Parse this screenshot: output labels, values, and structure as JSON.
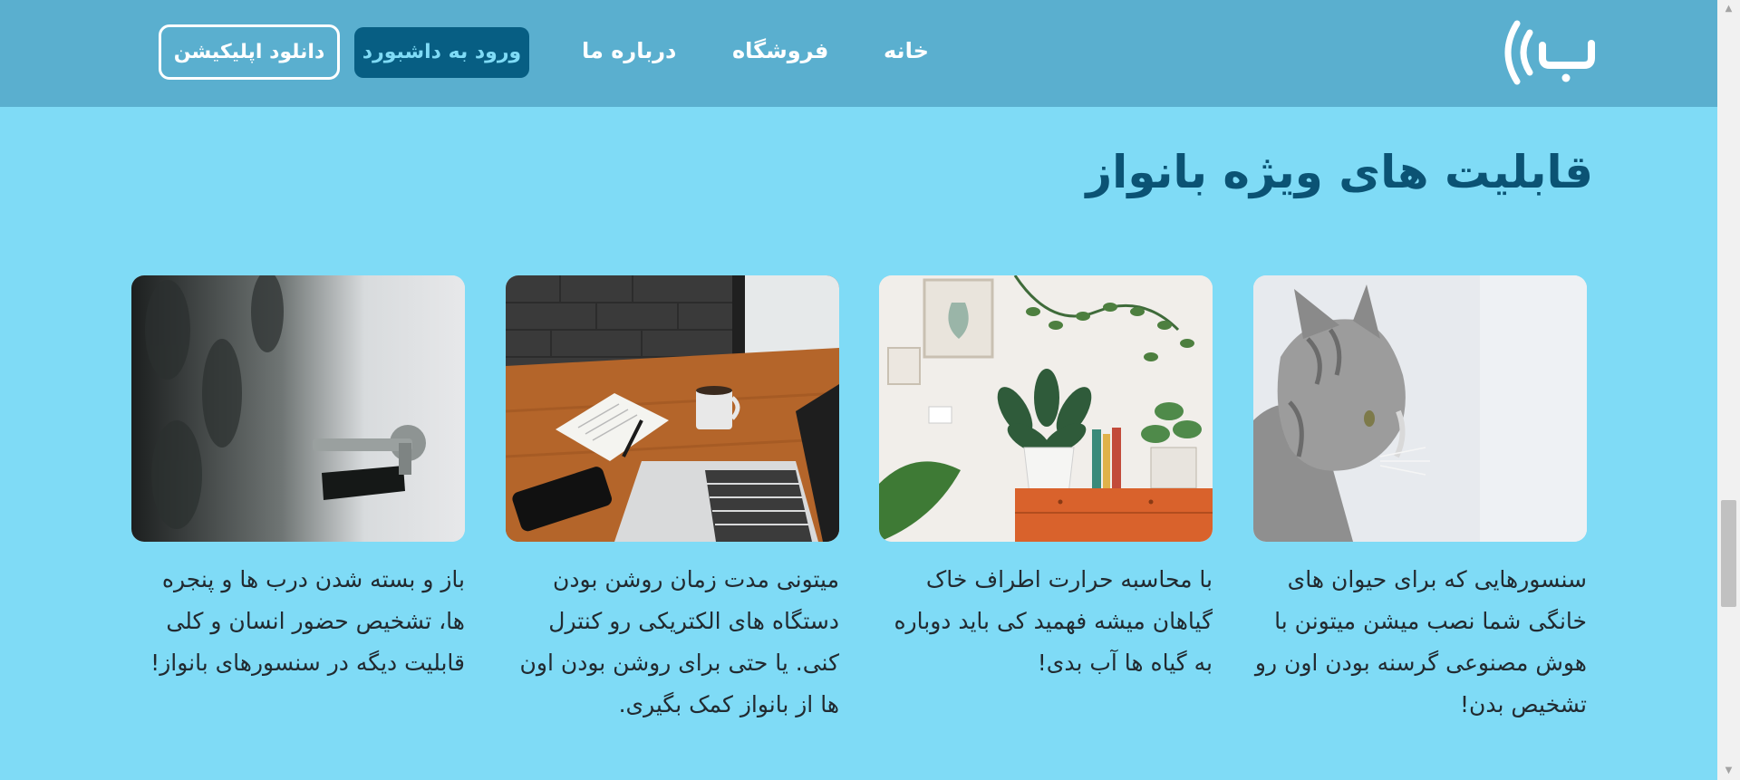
{
  "header": {
    "logo_alt": "بانواز",
    "nav": {
      "home": "خانه",
      "shop": "فروشگاه",
      "about": "درباره ما"
    },
    "dashboard_button": "ورود به داشبورد",
    "download_button": "دانلود اپلیکیشن"
  },
  "section": {
    "title": "قابلیت های ویژه بانواز"
  },
  "cards": [
    {
      "image": "cat-photo",
      "text": "سنسورهایی که برای حیوان های خانگی شما نصب میشن میتونن با هوش مصنوعی گرسنه بودن اون رو تشخیص بدن!"
    },
    {
      "image": "houseplants-photo",
      "text": "با محاسبه حرارت اطراف خاک گیاهان میشه فهمید کی باید دوباره به گیاه ها آب بدی!"
    },
    {
      "image": "laptop-desk-photo",
      "text": "میتونی مدت زمان روشن بودن دستگاه های الکتریکی رو کنترل کنی. یا حتی برای روشن بودن اون ها از بانواز کمک بگیری."
    },
    {
      "image": "door-handle-photo",
      "text": "باز و بسته شدن درب ها و پنجره ها، تشخیص حضور انسان و کلی قابلیت دیگه در سنسورهای بانواز!"
    }
  ],
  "colors": {
    "page_bg": "#7fdbf6",
    "header_bg": "#5aafcf",
    "primary_dark": "#075e83",
    "title": "#0b5374"
  }
}
